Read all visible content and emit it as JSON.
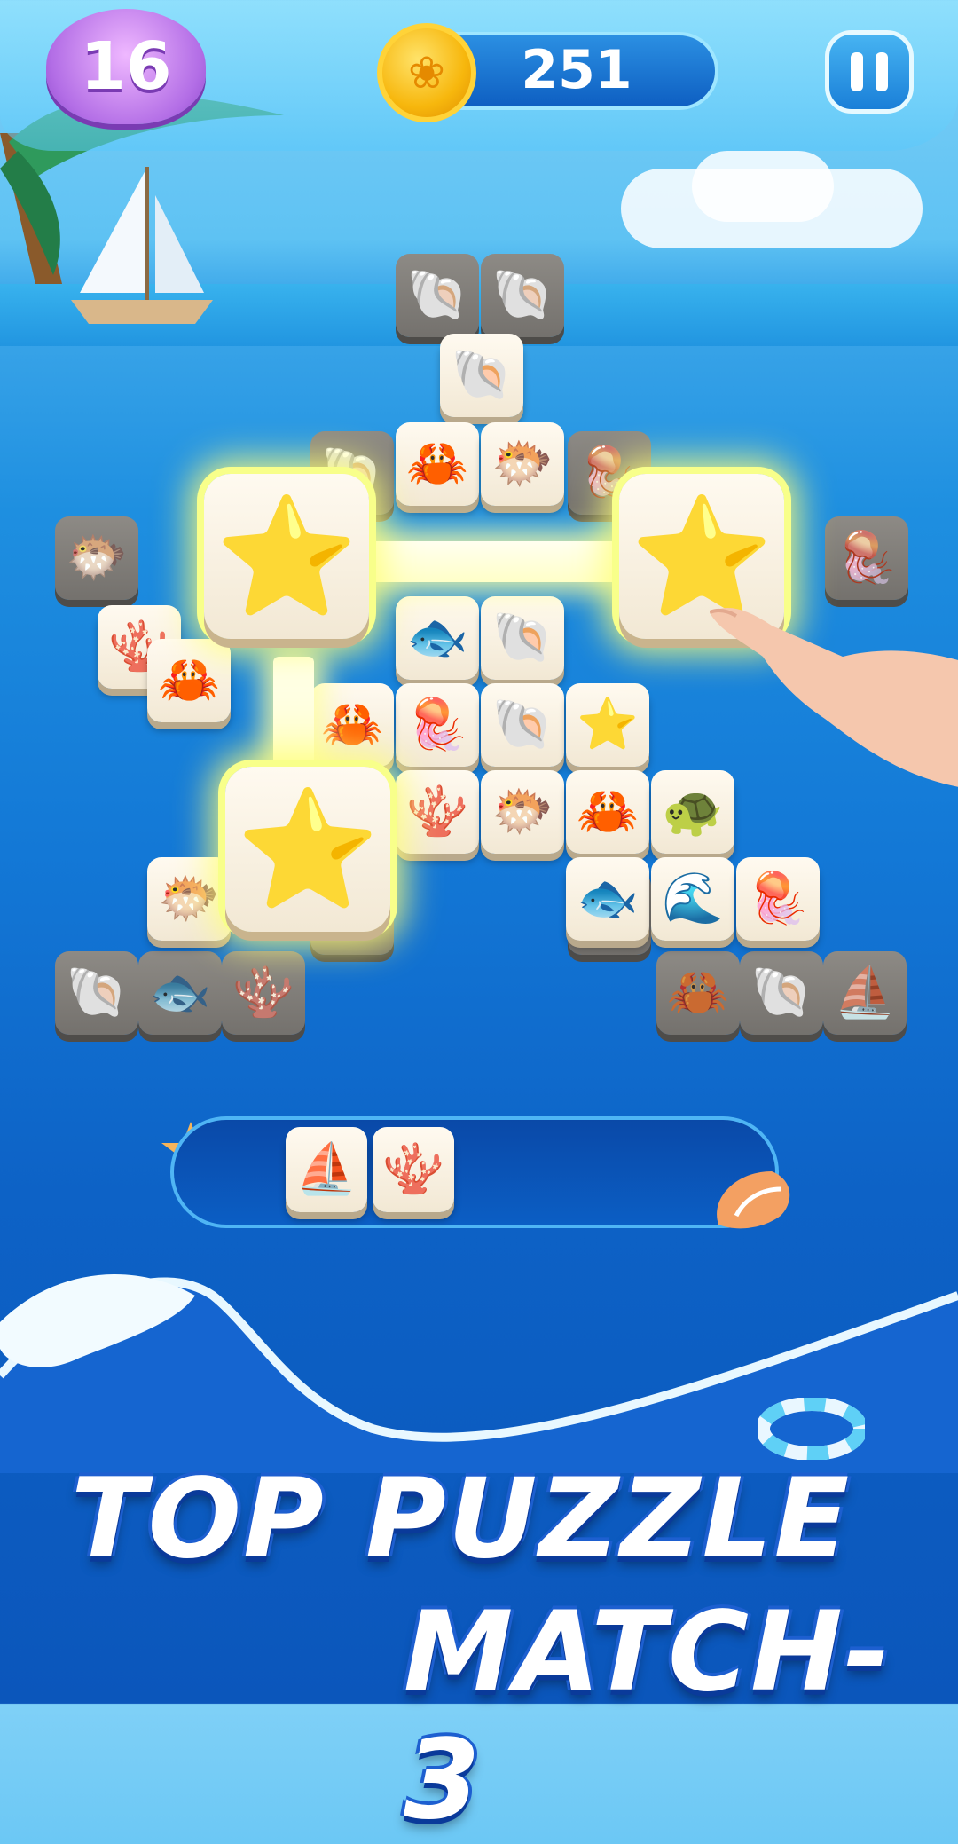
{
  "hud": {
    "level": "16",
    "coins": "251",
    "pause_icon": "pause-icon",
    "coin_icon": "gold-shell-coin-icon"
  },
  "board": {
    "selected_tiles": [
      {
        "icon": "starfish",
        "glyph": "⭐"
      },
      {
        "icon": "starfish",
        "glyph": "⭐"
      },
      {
        "icon": "starfish",
        "glyph": "⭐"
      }
    ],
    "tiles": [
      {
        "icon": "shell",
        "glyph": "🐚"
      },
      {
        "icon": "crab",
        "glyph": "🦀"
      },
      {
        "icon": "pufferfish",
        "glyph": "🐡"
      },
      {
        "icon": "fish",
        "glyph": "🐟"
      },
      {
        "icon": "shell",
        "glyph": "🐚"
      },
      {
        "icon": "jellyfish",
        "glyph": "🪼"
      },
      {
        "icon": "conch",
        "glyph": "🐚"
      },
      {
        "icon": "starfish",
        "glyph": "⭐"
      },
      {
        "icon": "crab",
        "glyph": "🦀"
      },
      {
        "icon": "coral",
        "glyph": "🪸"
      },
      {
        "icon": "pufferfish",
        "glyph": "🐡"
      },
      {
        "icon": "crab",
        "glyph": "🦀"
      },
      {
        "icon": "turtle",
        "glyph": "🐢"
      },
      {
        "icon": "pufferfish",
        "glyph": "🐡"
      },
      {
        "icon": "fish",
        "glyph": "🐟"
      },
      {
        "icon": "wave",
        "glyph": "🌊"
      },
      {
        "icon": "jellyfish",
        "glyph": "🪼"
      },
      {
        "icon": "coral",
        "glyph": "🪸"
      },
      {
        "icon": "crab",
        "glyph": "🦀"
      },
      {
        "icon": "crab",
        "glyph": "🦀"
      }
    ]
  },
  "tray": {
    "tiles": [
      {
        "icon": "sailboat",
        "glyph": "⛵"
      },
      {
        "icon": "coral",
        "glyph": "🪸"
      }
    ]
  },
  "title": {
    "line1": "TOP PUZZLE",
    "line2": "MATCH-3"
  },
  "colors": {
    "accent_yellow_glow": "#f8ff8a",
    "ocean_blue": "#1378d6",
    "level_purple": "#b36ee6",
    "coin_gold": "#f7b70d"
  }
}
